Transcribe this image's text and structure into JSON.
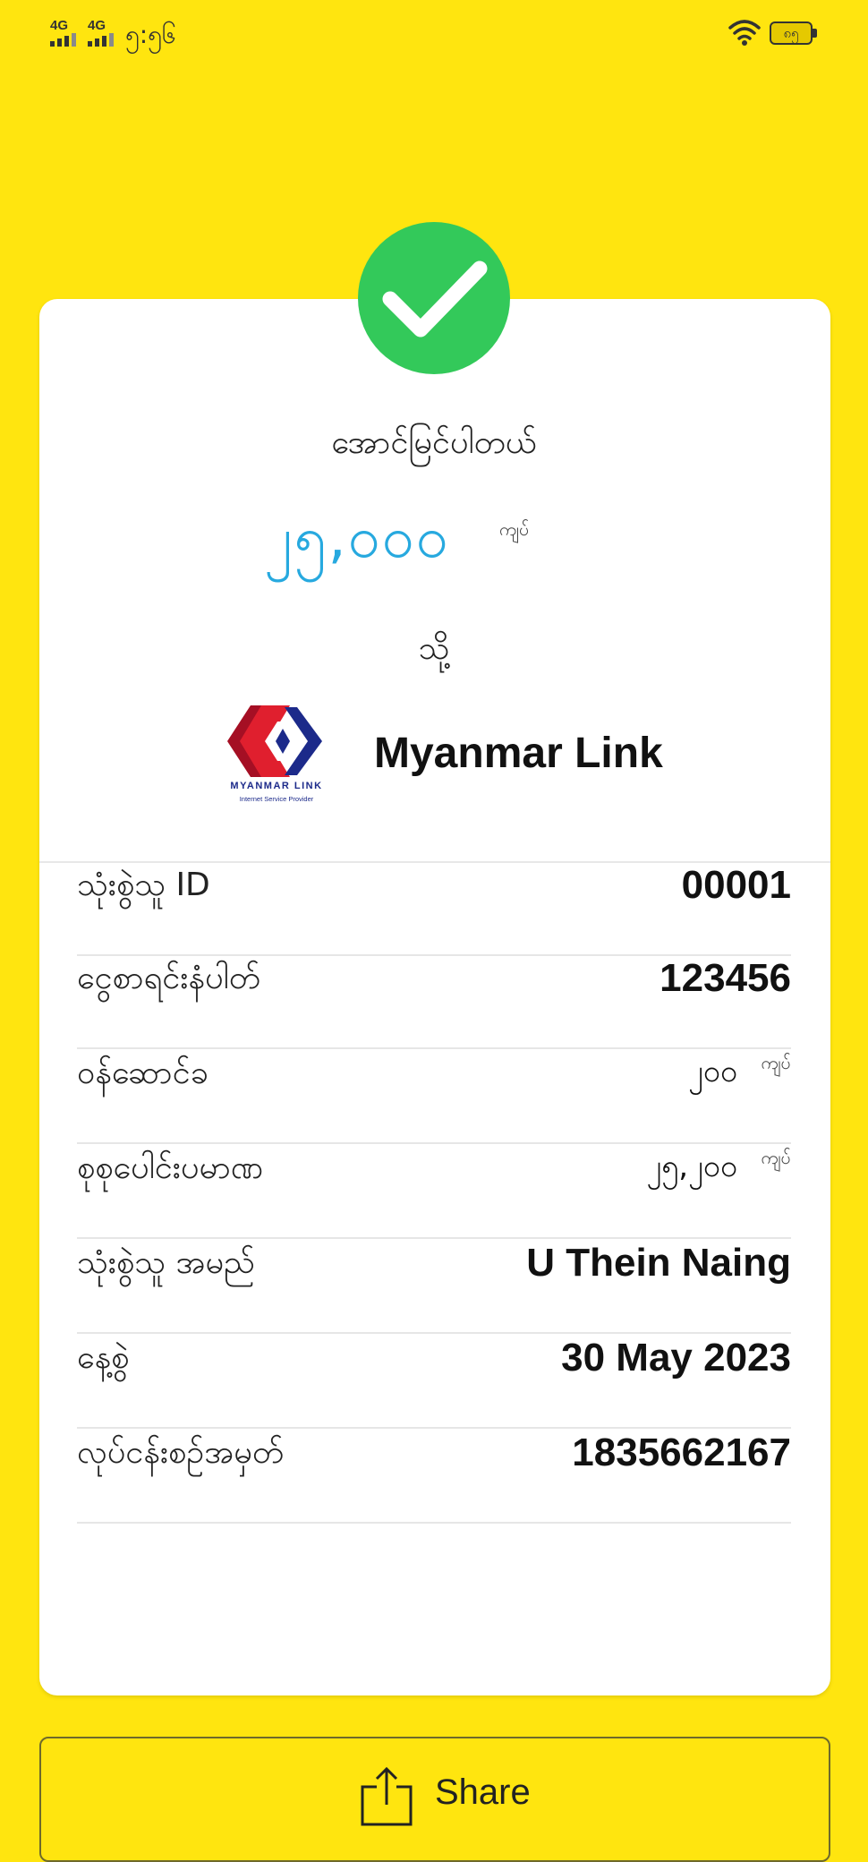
{
  "status_bar": {
    "network_1": "4G",
    "network_2": "4G",
    "time": "၅:၅၆",
    "battery_level": "၈၅",
    "icons": [
      "signal-icon",
      "signal-icon",
      "wifi-icon",
      "battery-icon"
    ]
  },
  "receipt": {
    "status_text": "အောင်မြင်ပါတယ်",
    "amount": "၂၅,၀၀၀",
    "amount_unit": "ကျပ်",
    "to_label": "သို့",
    "provider": {
      "name": "Myanmar Link",
      "logo_text": "MYANMAR LINK",
      "logo_subtext": "Internet Service Provider",
      "logo_colors": [
        "#C8102E",
        "#1C2A8A"
      ]
    },
    "details": [
      {
        "label": "သုံးစွဲသူ ID",
        "value": "00001"
      },
      {
        "label": "ငွေစာရင်းနံပါတ်",
        "value": "123456"
      },
      {
        "label": "ဝန်ဆောင်ခ",
        "value": "၂၀၀",
        "unit": "ကျပ်"
      },
      {
        "label": "စုစုပေါင်းပမာဏ",
        "value": "၂၅,၂၀၀",
        "unit": "ကျပ်"
      },
      {
        "label": "သုံးစွဲသူ အမည်",
        "value": "U Thein Naing"
      },
      {
        "label": "နေ့စွဲ",
        "value": "30 May 2023"
      },
      {
        "label": "လုပ်ငန်းစဉ်အမှတ်",
        "value": "1835662167"
      }
    ]
  },
  "actions": {
    "share_label": "Share"
  },
  "colors": {
    "background": "#FFE50F",
    "card": "#FFFFFF",
    "success": "#33C95A",
    "amount": "#27A9DF"
  }
}
